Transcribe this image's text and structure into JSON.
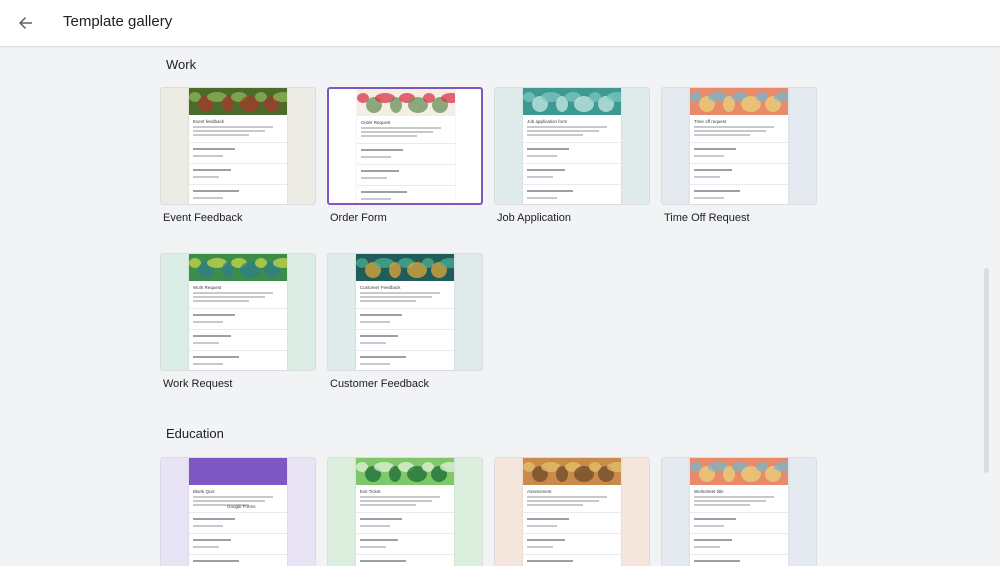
{
  "header": {
    "title": "Template gallery",
    "back_icon": "arrow-left-icon"
  },
  "sections": [
    {
      "title": "Work",
      "templates": [
        {
          "label": "Event Feedback",
          "form_title": "Event feedback",
          "thumb_bg": "#ecebe4",
          "banner_colors": [
            "#4a6b2a",
            "#8fb55a",
            "#a33a2b"
          ],
          "selected": false
        },
        {
          "label": "Order Form",
          "form_title": "Order Request",
          "thumb_bg": "#ffffff",
          "banner_colors": [
            "#f4eee4",
            "#d8344a",
            "#6a8f5a"
          ],
          "selected": true
        },
        {
          "label": "Job Application",
          "form_title": "Job application form",
          "thumb_bg": "#e0ecec",
          "banner_colors": [
            "#3d9a92",
            "#7cc4bd",
            "#c8e8e4"
          ],
          "selected": false
        },
        {
          "label": "Time Off Request",
          "form_title": "Time off request",
          "thumb_bg": "#e4eaf0",
          "banner_colors": [
            "#e98a6a",
            "#7ab4c9",
            "#e8d27a"
          ],
          "selected": false
        }
      ]
    },
    {
      "title": "",
      "templates": [
        {
          "label": "Work Request",
          "form_title": "Work Request",
          "thumb_bg": "#dcede6",
          "banner_colors": [
            "#3c8c4a",
            "#c7d84a",
            "#2d7f8c"
          ],
          "selected": false
        },
        {
          "label": "Customer Feedback",
          "form_title": "Customer Feedback",
          "thumb_bg": "#dfeceb",
          "banner_colors": [
            "#1f5c5a",
            "#4caf8f",
            "#e0a83a"
          ],
          "selected": false
        }
      ]
    },
    {
      "title": "Education",
      "templates": [
        {
          "label": "",
          "form_title": "Blank Quiz",
          "thumb_bg": "#e8e4f6",
          "banner_colors": [
            "#7e57c2",
            "#7e57c2",
            "#7e57c2"
          ],
          "footer": "Google Forms",
          "selected": false
        },
        {
          "label": "",
          "form_title": "Exit Ticket",
          "thumb_bg": "#dcefdf",
          "banner_colors": [
            "#7ec86a",
            "#e4f3da",
            "#1e6b3a"
          ],
          "selected": false
        },
        {
          "label": "",
          "form_title": "Assessment",
          "thumb_bg": "#f4e6dc",
          "banner_colors": [
            "#c98a4a",
            "#e6c070",
            "#6b4a2a"
          ],
          "selected": false
        },
        {
          "label": "",
          "form_title": "Worksheet title",
          "thumb_bg": "#e4eaf0",
          "banner_colors": [
            "#e98a6a",
            "#7ab4c9",
            "#e8d27a"
          ],
          "selected": false
        }
      ]
    }
  ]
}
